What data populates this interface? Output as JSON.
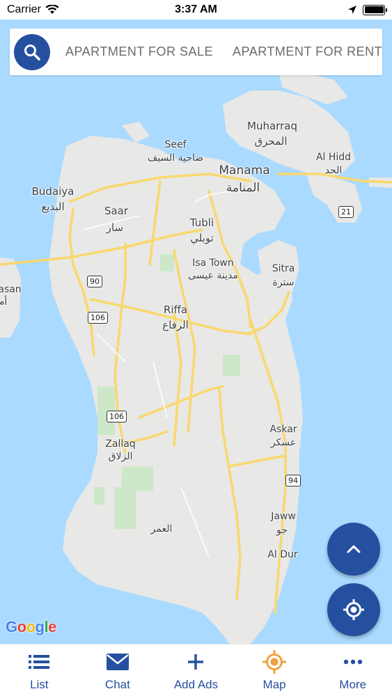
{
  "status_bar": {
    "carrier": "Carrier",
    "time": "3:37 AM"
  },
  "search": {
    "tabs": [
      "APARTMENT FOR SALE",
      "APARTMENT FOR RENT"
    ]
  },
  "map": {
    "places": {
      "muharraq_en": "Muharraq",
      "muharraq_ar": "المحرق",
      "seef_en": "Seef",
      "seef_ar": "ضاحية السيف",
      "al_hidd_en": "Al Hidd",
      "al_hidd_ar": "الحد",
      "manama_en": "Manama",
      "manama_ar": "المنامة",
      "budaiya_en": "Budaiya",
      "budaiya_ar": "البديع",
      "saar_en": "Saar",
      "saar_ar": "سار",
      "tubli_en": "Tubli",
      "tubli_ar": "توبلي",
      "isa_town_en": "Isa Town",
      "isa_town_ar": "مدينة عيسى",
      "sitra_en": "Sitra",
      "sitra_ar": "سترة",
      "hasan_en": "asan",
      "hasan_ar": "أم",
      "riffa_en": "Riffa",
      "riffa_ar": "الرفاع",
      "zallaq_en": "Zallaq",
      "zallaq_ar": "الزلاق",
      "askar_en": "Askar",
      "askar_ar": "عسكر",
      "jaww_en": "Jaww",
      "jaww_ar": "جو",
      "al_dur_en": "Al Dur",
      "al_omar_ar": "العمر"
    },
    "route_shields": [
      "21",
      "90",
      "106",
      "106",
      "94"
    ],
    "attribution": "Google"
  },
  "tab_bar": {
    "items": [
      {
        "label": "List",
        "icon": "list-icon"
      },
      {
        "label": "Chat",
        "icon": "mail-icon"
      },
      {
        "label": "Add Ads",
        "icon": "plus-icon"
      },
      {
        "label": "Map",
        "icon": "map-target-icon"
      },
      {
        "label": "More",
        "icon": "more-icon"
      }
    ]
  },
  "colors": {
    "primary": "#2550a0",
    "water": "#aadaff",
    "land": "#e8e8e6",
    "road": "#f9d86d",
    "map_active": "#f0a040"
  }
}
